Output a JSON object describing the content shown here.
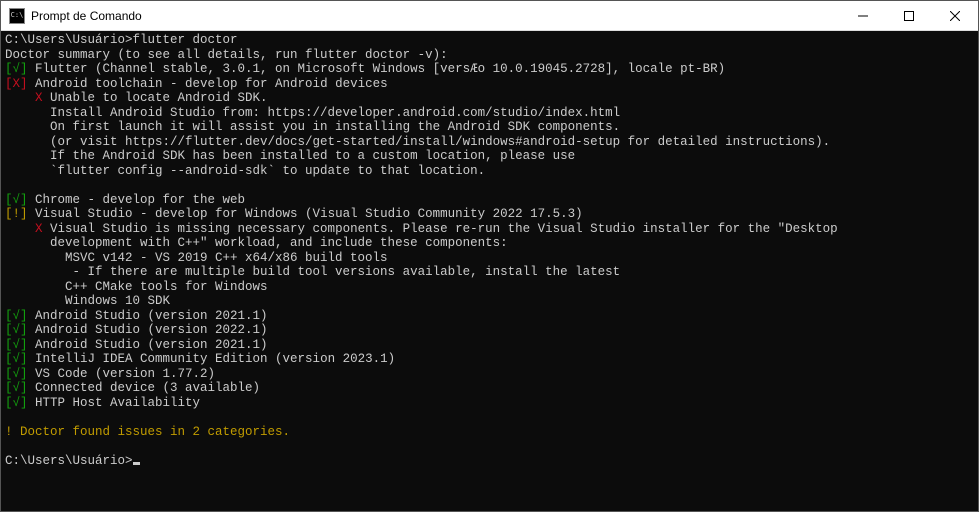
{
  "window": {
    "title": "Prompt de Comando"
  },
  "terminal": {
    "prompt1_path": "C:\\Users\\Usuário>",
    "prompt1_cmd": "flutter doctor",
    "summary_line": "Doctor summary (to see all details, run flutter doctor -v):",
    "flutter_ok": "[√]",
    "flutter_line": " Flutter (Channel stable, 3.0.1, on Microsoft Windows [versÆo 10.0.19045.2728], locale pt-BR)",
    "android_fail": "[X]",
    "android_line": " Android toolchain - develop for Android devices",
    "android_x": "    X",
    "android_x_text": " Unable to locate Android SDK.",
    "android_detail1": "      Install Android Studio from: https://developer.android.com/studio/index.html",
    "android_detail2": "      On first launch it will assist you in installing the Android SDK components.",
    "android_detail3": "      (or visit https://flutter.dev/docs/get-started/install/windows#android-setup for detailed instructions).",
    "android_detail4": "      If the Android SDK has been installed to a custom location, please use",
    "android_detail5": "      `flutter config --android-sdk` to update to that location.",
    "blank1": "",
    "chrome_ok": "[√]",
    "chrome_line": " Chrome - develop for the web",
    "vs_warn": "[!]",
    "vs_line": " Visual Studio - develop for Windows (Visual Studio Community 2022 17.5.3)",
    "vs_x": "    X",
    "vs_x_text": " Visual Studio is missing necessary components. Please re-run the Visual Studio installer for the \"Desktop",
    "vs_detail1": "      development with C++\" workload, and include these components:",
    "vs_detail2": "        MSVC v142 - VS 2019 C++ x64/x86 build tools",
    "vs_detail3": "         - If there are multiple build tool versions available, install the latest",
    "vs_detail4": "        C++ CMake tools for Windows",
    "vs_detail5": "        Windows 10 SDK",
    "as1_ok": "[√]",
    "as1_line": " Android Studio (version 2021.1)",
    "as2_ok": "[√]",
    "as2_line": " Android Studio (version 2022.1)",
    "as3_ok": "[√]",
    "as3_line": " Android Studio (version 2021.1)",
    "ij_ok": "[√]",
    "ij_line": " IntelliJ IDEA Community Edition (version 2023.1)",
    "vscode_ok": "[√]",
    "vscode_line": " VS Code (version 1.77.2)",
    "conn_ok": "[√]",
    "conn_line": " Connected device (3 available)",
    "http_ok": "[√]",
    "http_line": " HTTP Host Availability",
    "blank2": "",
    "issues_line": "! Doctor found issues in 2 categories.",
    "blank3": "",
    "prompt2_path": "C:\\Users\\Usuário>"
  }
}
